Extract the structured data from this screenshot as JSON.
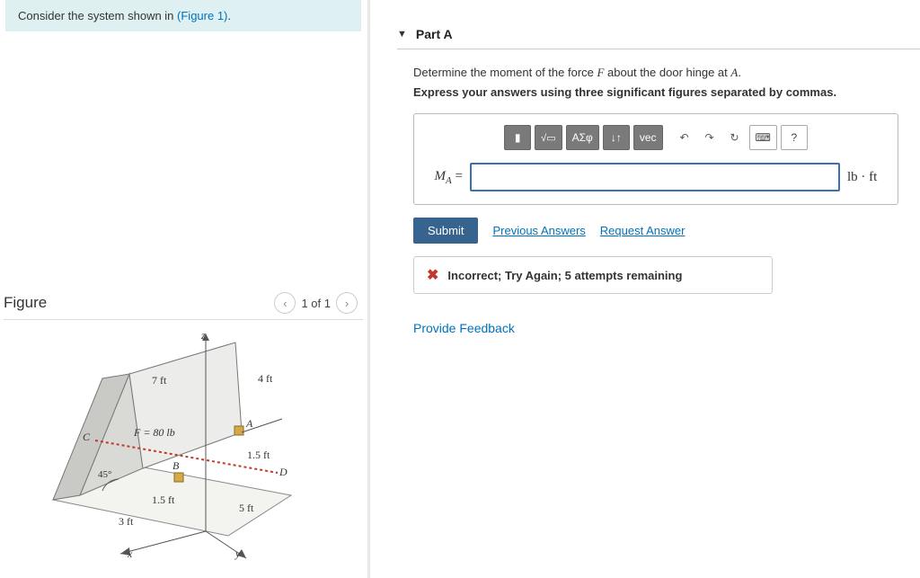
{
  "prompt": {
    "prefix": "Consider the system shown in ",
    "link": "(Figure 1)",
    "suffix": "."
  },
  "figure": {
    "title": "Figure",
    "pager": "1 of 1",
    "labels": {
      "z": "z",
      "y": "y",
      "x": "x",
      "seven_ft": "7 ft",
      "four_ft": "4 ft",
      "force": "F = 80 lb",
      "C": "C",
      "A": "A",
      "B": "B",
      "D": "D",
      "onefive_ft_upper": "1.5 ft",
      "onefive_ft_lower": "1.5 ft",
      "five_ft": "5 ft",
      "three_ft": "3 ft",
      "angle": "45°"
    }
  },
  "part": {
    "title": "Part A",
    "question_prefix": "Determine the moment of the force ",
    "force_sym": "F",
    "question_mid": " about the door hinge at ",
    "point_sym": "A",
    "question_end": ".",
    "instruction": "Express your answers using three significant figures separated by commas.",
    "toolbar": {
      "templates": "ΑΣφ",
      "sub": "↓↑",
      "vec": "vec",
      "help": "?"
    },
    "var_label_main": "M",
    "var_label_sub": "A",
    "equals": " = ",
    "input_value": "",
    "units": "lb · ft",
    "submit": "Submit",
    "prev": "Previous Answers",
    "request": "Request Answer",
    "feedback": "Incorrect; Try Again; 5 attempts remaining"
  },
  "provide_feedback": "Provide Feedback"
}
